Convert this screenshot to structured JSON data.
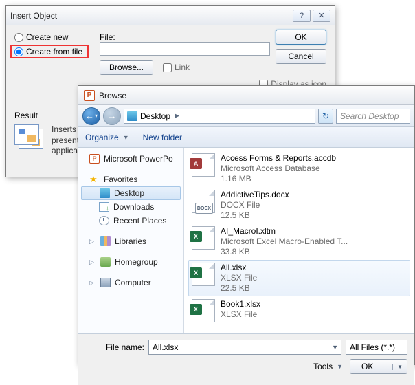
{
  "insert": {
    "title": "Insert Object",
    "create_new": "Create new",
    "create_from_file": "Create from file",
    "file_label": "File:",
    "browse": "Browse...",
    "link": "Link",
    "display_as_icon": "Display as icon",
    "ok": "OK",
    "cancel": "Cancel",
    "result_label": "Result",
    "result_text": "Inserts present applicatio"
  },
  "browse": {
    "title": "Browse",
    "crumb": "Desktop",
    "search_placeholder": "Search Desktop",
    "organize": "Organize",
    "new_folder": "New folder",
    "nav": {
      "ppt": "Microsoft PowerPo",
      "favorites": "Favorites",
      "desktop": "Desktop",
      "downloads": "Downloads",
      "recent": "Recent Places",
      "libraries": "Libraries",
      "homegroup": "Homegroup",
      "computer": "Computer"
    },
    "files": [
      {
        "name": "Access Forms & Reports.accdb",
        "type": "Microsoft Access Database",
        "size": "1.16 MB"
      },
      {
        "name": "AddictiveTips.docx",
        "type": "DOCX File",
        "size": "12.5 KB"
      },
      {
        "name": "AI_MacroI.xltm",
        "type": "Microsoft Excel Macro-Enabled T...",
        "size": "33.8 KB"
      },
      {
        "name": "All.xlsx",
        "type": "XLSX File",
        "size": "22.5 KB"
      },
      {
        "name": "Book1.xlsx",
        "type": "XLSX File",
        "size": ""
      }
    ],
    "filename_label": "File name:",
    "filename_value": "All.xlsx",
    "filter": "All Files (*.*)",
    "tools": "Tools",
    "ok": "OK"
  }
}
